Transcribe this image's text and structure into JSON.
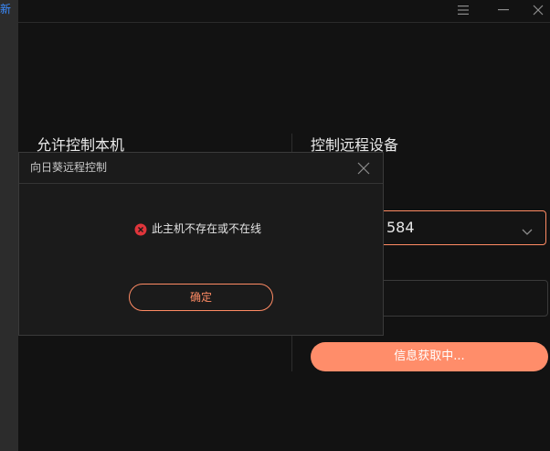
{
  "sidebar": {
    "tab_label": "新"
  },
  "window": {
    "menu_icon": "hamburger-icon",
    "minimize_icon": "minimize-icon",
    "close_icon": "close-icon"
  },
  "main": {
    "local_title": "允许控制本机",
    "remote_title": "控制远程设备",
    "device_id_value": "584",
    "connect_button_label": "信息获取中..."
  },
  "dialog": {
    "title": "向日葵远程控制",
    "message": "此主机不存在或不在线",
    "confirm_label": "确定",
    "error_icon": "error-circle-icon"
  },
  "colors": {
    "accent": "#ff8b64",
    "button_fill": "#ff8d6a",
    "error": "#e0353b",
    "background": "#121212",
    "dialog_background": "#1b1b1b",
    "link_blue": "#3b8cff"
  }
}
